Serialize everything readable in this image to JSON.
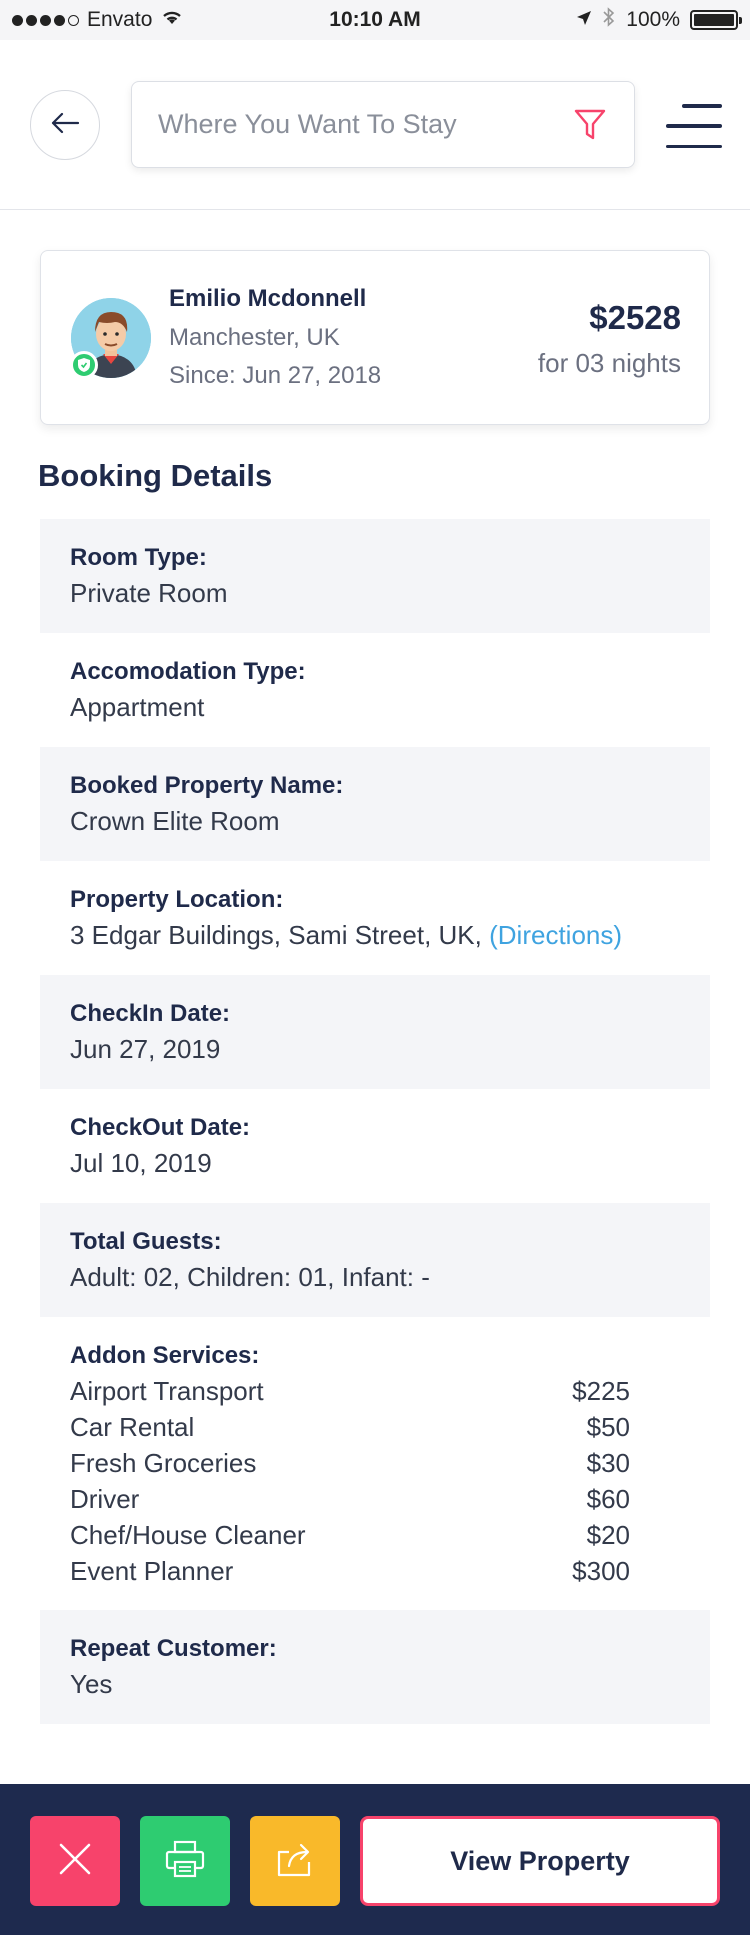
{
  "status_bar": {
    "carrier": "Envato",
    "time": "10:10 AM",
    "battery": "100%",
    "battery_level": 1.0
  },
  "header": {
    "search_placeholder": "Where You Want To Stay"
  },
  "customer": {
    "name": "Emilio Mcdonnell",
    "location": "Manchester, UK",
    "since": "Since: Jun 27, 2018",
    "price": "$2528",
    "nights": "for 03 nights"
  },
  "booking": {
    "title": "Booking Details",
    "room_type": {
      "label": "Room Type:",
      "value": "Private Room"
    },
    "accommodation_type": {
      "label": "Accomodation Type:",
      "value": "Appartment"
    },
    "property_name": {
      "label": "Booked Property Name:",
      "value": "Crown Elite Room"
    },
    "property_location": {
      "label": "Property Location:",
      "value": "3 Edgar Buildings, Sami Street, UK,",
      "link": "(Directions)"
    },
    "checkin": {
      "label": "CheckIn Date:",
      "value": "Jun 27, 2019"
    },
    "checkout": {
      "label": "CheckOut Date:",
      "value": "Jul 10, 2019"
    },
    "guests": {
      "label": "Total Guests:",
      "value": "Adult: 02, Children: 01, Infant: -"
    },
    "addons": {
      "label": "Addon Services:",
      "items": [
        {
          "name": "Airport Transport",
          "price": "$225"
        },
        {
          "name": "Car Rental",
          "price": "$50"
        },
        {
          "name": "Fresh Groceries",
          "price": "$30"
        },
        {
          "name": "Driver",
          "price": "$60"
        },
        {
          "name": "Chef/House Cleaner",
          "price": "$20"
        },
        {
          "name": "Event Planner",
          "price": "$300"
        }
      ]
    },
    "repeat_customer": {
      "label": "Repeat Customer:",
      "value": "Yes"
    }
  },
  "bottom_bar": {
    "view_property_label": "View Property"
  },
  "colors": {
    "primary": "#1f2a4a",
    "bottom_bar": "#1e2a4e",
    "cancel": "#f7436b",
    "print": "#2ecc71",
    "share": "#f9b92a",
    "link": "#3fa3e0",
    "row_shade": "#f4f5f8"
  },
  "icons": {
    "back": "arrow-left-icon",
    "filter": "funnel-icon",
    "menu": "hamburger-menu-icon",
    "verified": "shield-check-icon",
    "cancel": "close-icon",
    "print": "printer-icon",
    "share": "share-icon"
  }
}
